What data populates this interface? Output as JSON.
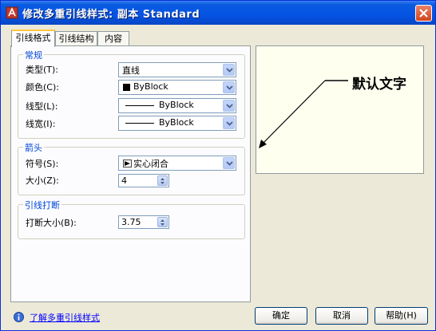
{
  "window": {
    "title": "修改多重引线样式: 副本 Standard"
  },
  "tabs": [
    {
      "label": "引线格式"
    },
    {
      "label": "引线结构"
    },
    {
      "label": "内容"
    }
  ],
  "general": {
    "title": "常规",
    "type_label": "类型(T):",
    "type_value": "直线",
    "color_label": "颜色(C):",
    "color_value": "ByBlock",
    "linetype_label": "线型(L):",
    "linetype_value": "ByBlock",
    "lineweight_label": "线宽(I):",
    "lineweight_value": "ByBlock"
  },
  "arrowhead": {
    "title": "箭头",
    "symbol_label": "符号(S):",
    "symbol_value": "实心闭合",
    "size_label": "大小(Z):",
    "size_value": "4"
  },
  "leader_break": {
    "title": "引线打断",
    "break_size_label": "打断大小(B):",
    "break_size_value": "3.75"
  },
  "preview": {
    "text": "默认文字"
  },
  "footer": {
    "help_link": "了解多重引线样式",
    "ok_label": "确定",
    "cancel_label": "取消",
    "help_label": "帮助(H)"
  },
  "icons": {
    "app": "autocad-app-icon",
    "close": "close-icon",
    "info": "info-icon",
    "dropdown": "chevron-down-icon",
    "spinner": "spinner-arrows-icon",
    "arrow_symbol": "closed-filled-arrow-icon"
  },
  "colors": {
    "title_bar": "#0553e4",
    "group_title": "#0046d5",
    "link": "#0000ff",
    "preview_bg": "#fffff0"
  }
}
